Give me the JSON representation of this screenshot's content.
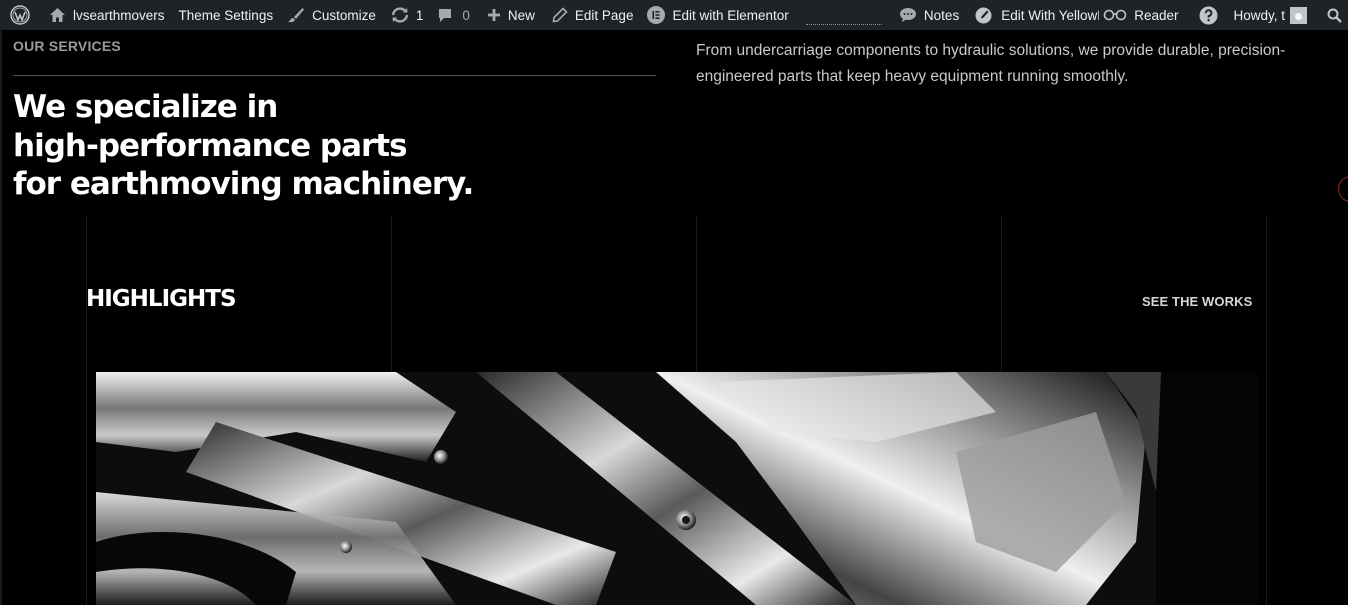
{
  "adminbar": {
    "site_name": "lvsearthmovers",
    "theme_settings": "Theme Settings",
    "customize": "Customize",
    "updates_count": "1",
    "comments_count": "0",
    "new": "New",
    "edit_page": "Edit Page",
    "edit_elementor": "Edit with Elementor",
    "notes": "Notes",
    "edit_yellow": "Edit With YellowP",
    "reader": "Reader",
    "howdy": "Howdy, t"
  },
  "services": {
    "label": "OUR SERVICES",
    "headline_line1": "We specialize in",
    "headline_line2": "high-performance parts",
    "headline_line3": "for earthmoving machinery.",
    "intro": "From undercarriage components to hydraulic solutions, we provide durable, precision-engineered parts that keep heavy equipment running smoothly."
  },
  "highlights": {
    "title": "HIGHLIGHTS",
    "link": "SEE THE WORKS",
    "image": "machinery-parts-image"
  },
  "colors": {
    "adminbar_bg": "#1d2327",
    "page_bg": "#000000",
    "heading": "#ffffff",
    "body_text": "#c9c9c9"
  }
}
